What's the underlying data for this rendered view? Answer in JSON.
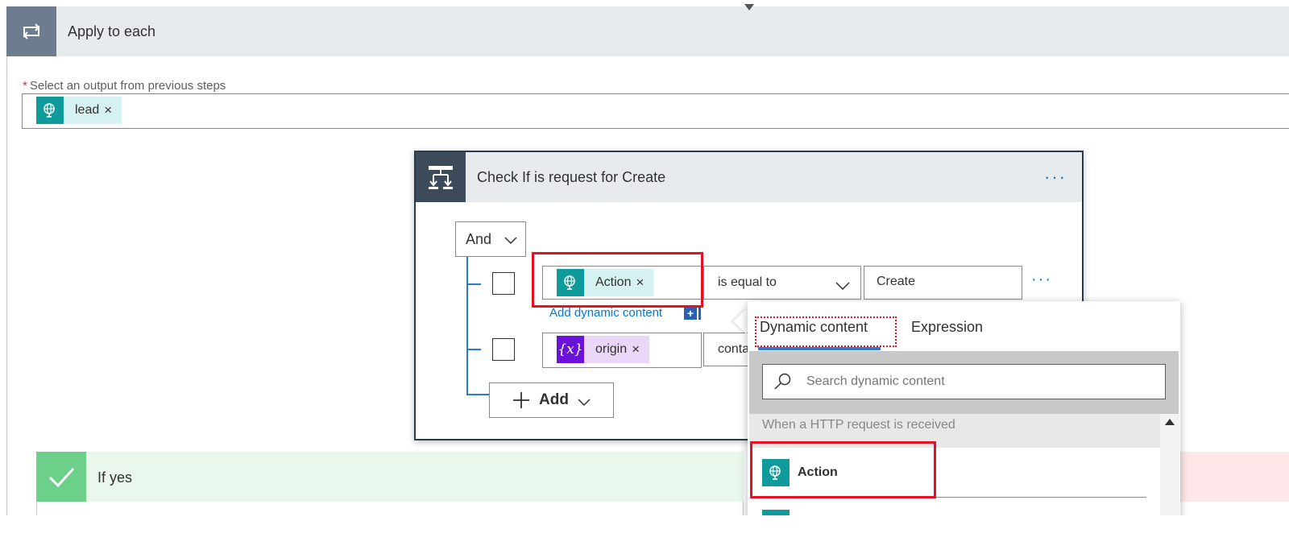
{
  "apply_to_each": {
    "title": "Apply to each",
    "output_label": "Select an output from previous steps",
    "required_marker": "*",
    "output_token": {
      "label": "lead",
      "remove": "×",
      "icon": "globe-request-icon"
    }
  },
  "condition": {
    "title": "Check If is request for Create",
    "more": "···",
    "group_operator": "And",
    "rows": [
      {
        "left_token": "Action",
        "remove": "×",
        "operator": "is equal to",
        "value": "Create",
        "more": "···"
      },
      {
        "left_token": "origin",
        "remove": "×",
        "token_icon": "{x}",
        "operator": "conta"
      }
    ],
    "add_dynamic_content": "Add dynamic content",
    "add_dynamic_plus": "+",
    "add_button": "Add"
  },
  "branches": {
    "yes_title": "If yes"
  },
  "dynamic_popup": {
    "tabs": [
      "Dynamic content",
      "Expression"
    ],
    "search_placeholder": "Search dynamic content",
    "section_title": "When a HTTP request is received",
    "items": [
      {
        "label": "Action",
        "icon": "globe-request-icon"
      }
    ]
  },
  "colors": {
    "accent_blue": "#0078d4",
    "token_teal": "#0f9b9b",
    "token_purple": "#6b12d8",
    "highlight_red": "#e81123",
    "yes_green": "#6ccf8a"
  }
}
